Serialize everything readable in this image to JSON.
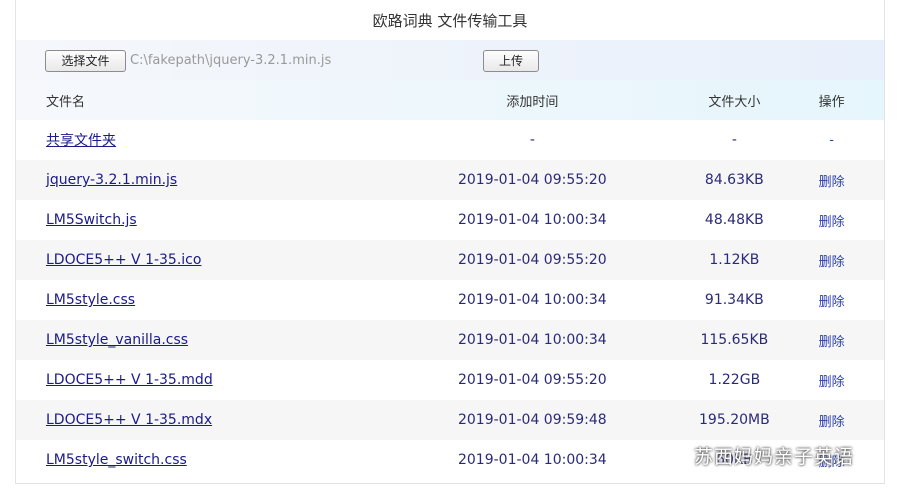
{
  "app": {
    "title": "欧路词典 文件传输工具"
  },
  "upload": {
    "choose_label": "选择文件",
    "file_path": "C:\\fakepath\\jquery-3.2.1.min.js",
    "upload_label": "上传"
  },
  "table": {
    "headers": {
      "name": "文件名",
      "time": "添加时间",
      "size": "文件大小",
      "op": "操作"
    },
    "rows": [
      {
        "name": "共享文件夹",
        "time": "-",
        "size": "-",
        "op": "-"
      },
      {
        "name": "jquery-3.2.1.min.js",
        "time": "2019-01-04 09:55:20",
        "size": "84.63KB",
        "op": "删除"
      },
      {
        "name": "LM5Switch.js",
        "time": "2019-01-04 10:00:34",
        "size": "48.48KB",
        "op": "删除"
      },
      {
        "name": "LDOCE5++ V 1-35.ico",
        "time": "2019-01-04 09:55:20",
        "size": "1.12KB",
        "op": "删除"
      },
      {
        "name": "LM5style.css",
        "time": "2019-01-04 10:00:34",
        "size": "91.34KB",
        "op": "删除"
      },
      {
        "name": "LM5style_vanilla.css",
        "time": "2019-01-04 10:00:34",
        "size": "115.65KB",
        "op": "删除"
      },
      {
        "name": "LDOCE5++ V 1-35.mdd",
        "time": "2019-01-04 09:55:20",
        "size": "1.22GB",
        "op": "删除"
      },
      {
        "name": "LDOCE5++ V 1-35.mdx",
        "time": "2019-01-04 09:59:48",
        "size": "195.20MB",
        "op": "删除"
      },
      {
        "name": "LM5style_switch.css",
        "time": "2019-01-04 10:00:34",
        "size": "60KB",
        "op": "删除"
      }
    ]
  },
  "watermark": {
    "text": "苏西妈妈亲子英语"
  }
}
